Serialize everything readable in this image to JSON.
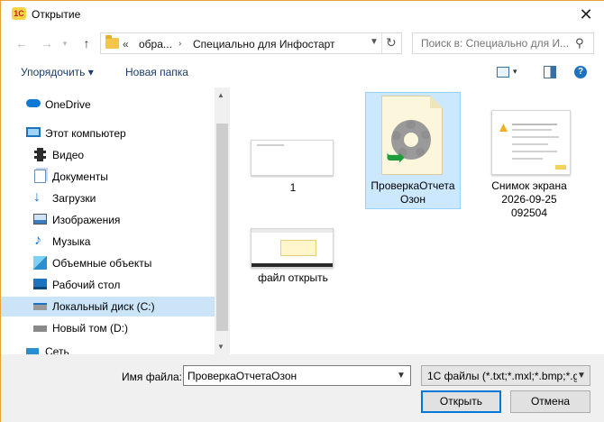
{
  "window": {
    "title": "Открытие",
    "app_logo_text": "1С"
  },
  "nav": {
    "address_prefix": "«",
    "address_parts": [
      "обра...",
      "Специально для Инфостарт"
    ],
    "search_placeholder": "Поиск в: Специально для И..."
  },
  "toolbar": {
    "organize": "Упорядочить ▾",
    "new_folder": "Новая папка"
  },
  "sidebar": {
    "items": [
      {
        "label": "OneDrive",
        "icon": "cloud-icon"
      },
      {
        "label": "Этот компьютер",
        "icon": "computer-icon"
      },
      {
        "label": "Видео",
        "icon": "video-icon"
      },
      {
        "label": "Документы",
        "icon": "documents-icon"
      },
      {
        "label": "Загрузки",
        "icon": "downloads-icon"
      },
      {
        "label": "Изображения",
        "icon": "pictures-icon"
      },
      {
        "label": "Музыка",
        "icon": "music-icon"
      },
      {
        "label": "Объемные объекты",
        "icon": "3d-objects-icon"
      },
      {
        "label": "Рабочий стол",
        "icon": "desktop-icon"
      },
      {
        "label": "Локальный диск (C:)",
        "icon": "drive-icon"
      },
      {
        "label": "Новый том (D:)",
        "icon": "drive-icon"
      },
      {
        "label": "Сеть",
        "icon": "network-icon"
      }
    ],
    "selected_index": 9
  },
  "files": [
    {
      "name_lines": [
        "1"
      ]
    },
    {
      "name_lines": [
        "ПроверкаОтчета",
        "Озон"
      ],
      "selected": true
    },
    {
      "name_lines": [
        "Снимок экрана",
        "2026-09-25",
        "092504"
      ]
    },
    {
      "name_lines": [
        "файл открыть"
      ]
    }
  ],
  "bottom": {
    "filename_label": "Имя файла:",
    "filename_value": "ПроверкаОтчетаОзон",
    "filetype_value": "1С файлы (*.txt;*.mxl;*.bmp;*.g",
    "open_button": "Открыть",
    "cancel_button": "Отмена"
  },
  "colors": {
    "accent": "#0078d7",
    "selection": "#cce8ff",
    "sidebar_selection": "#cce4f7"
  }
}
